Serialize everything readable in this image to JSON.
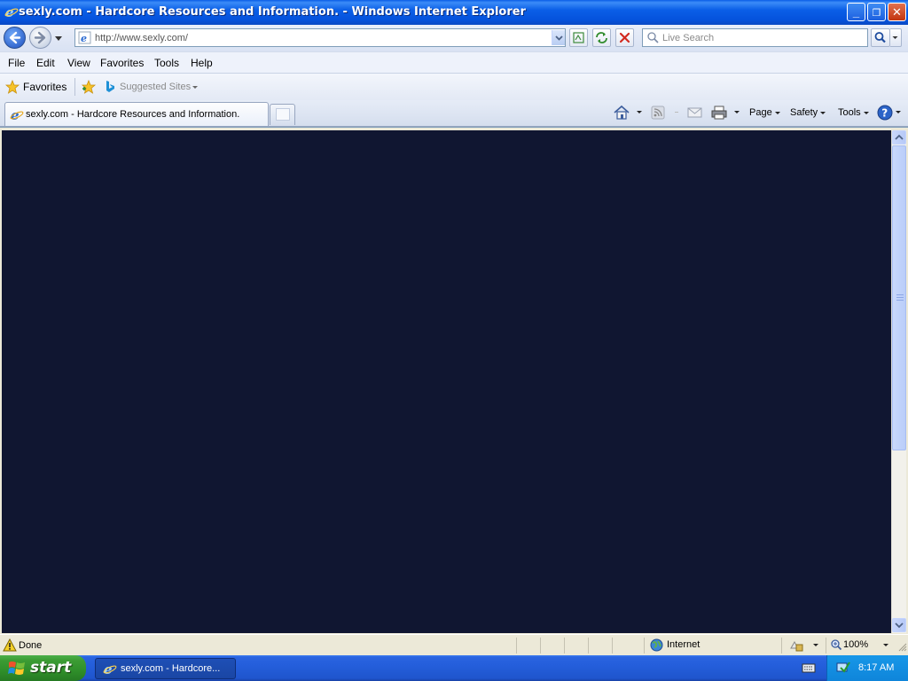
{
  "window": {
    "title": "sexly.com - Hardcore Resources and Information. - Windows Internet Explorer",
    "min_glyph": "_",
    "max_glyph": "❐",
    "close_glyph": "✕"
  },
  "address": {
    "url": "http://www.sexly.com/"
  },
  "search": {
    "placeholder": "Live Search"
  },
  "menu": {
    "items": [
      "File",
      "Edit",
      "View",
      "Favorites",
      "Tools",
      "Help"
    ]
  },
  "favorites_bar": {
    "favorites_label": "Favorites",
    "suggested_sites_label": "Suggested Sites"
  },
  "tab": {
    "active_title": "sexly.com - Hardcore Resources and Information."
  },
  "command_bar": {
    "page_label": "Page",
    "safety_label": "Safety",
    "tools_label": "Tools"
  },
  "status": {
    "text": "Done",
    "zone": "Internet",
    "zoom": "100%"
  },
  "taskbar": {
    "start_label": "start",
    "task_label": "sexly.com - Hardcore...",
    "clock": "8:17 AM"
  },
  "colors": {
    "page_background": "#101631",
    "titlebar": "#0a5de6",
    "taskbar": "#245edb",
    "start_button": "#3c9c34"
  }
}
